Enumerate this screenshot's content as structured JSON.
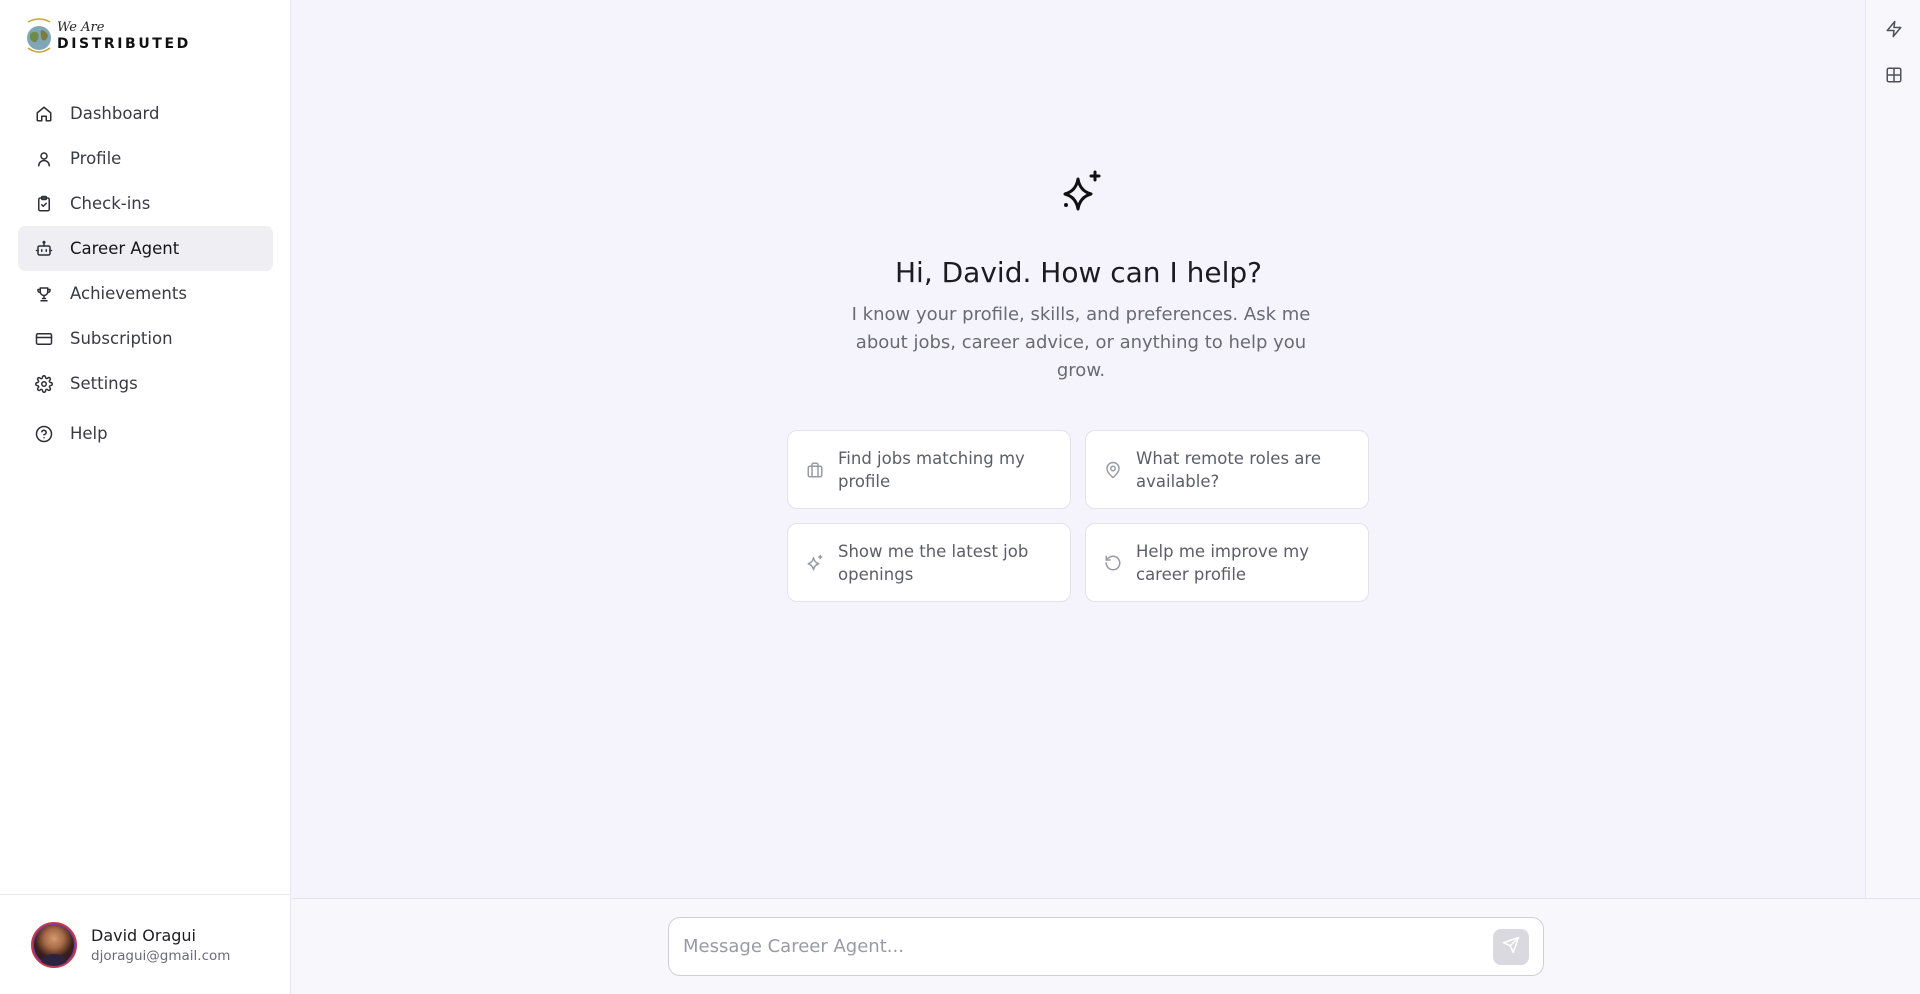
{
  "brand": {
    "line1": "We Are",
    "line2": "DISTRIBUTED"
  },
  "sidebar": {
    "items": [
      {
        "label": "Dashboard",
        "icon": "home-icon"
      },
      {
        "label": "Profile",
        "icon": "user-icon"
      },
      {
        "label": "Check-ins",
        "icon": "clipboard-check-icon"
      },
      {
        "label": "Career Agent",
        "icon": "bot-icon",
        "active": true
      },
      {
        "label": "Achievements",
        "icon": "trophy-icon"
      },
      {
        "label": "Subscription",
        "icon": "credit-card-icon"
      },
      {
        "label": "Settings",
        "icon": "gear-icon"
      },
      {
        "label": "Help",
        "icon": "help-circle-icon"
      }
    ]
  },
  "user": {
    "name": "David Oragui",
    "email": "djoragui@gmail.com"
  },
  "main": {
    "greeting": "Hi, David. How can I help?",
    "subtitle": "I know your profile, skills, and preferences. Ask me about jobs, career advice, or anything to help you grow.",
    "suggestions": [
      {
        "label": "Find jobs matching my profile",
        "icon": "briefcase-icon"
      },
      {
        "label": "What remote roles are available?",
        "icon": "map-pin-icon"
      },
      {
        "label": "Show me the latest job openings",
        "icon": "sparkles-icon"
      },
      {
        "label": "Help me improve my career profile",
        "icon": "refresh-icon"
      }
    ]
  },
  "composer": {
    "placeholder": "Message Career Agent..."
  },
  "rail": {
    "icons": [
      "lightning-icon",
      "layout-grid-icon"
    ]
  },
  "colors": {
    "background": "#f5f4fd",
    "active_item": "#efeff3",
    "send_disabled": "#d9d9df"
  }
}
